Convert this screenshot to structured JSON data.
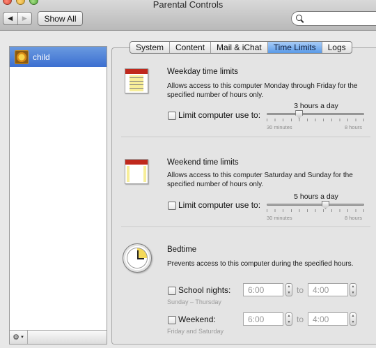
{
  "window": {
    "title": "Parental Controls",
    "show_all_label": "Show All",
    "back_glyph": "◀",
    "forward_glyph": "▶"
  },
  "search": {
    "value": "",
    "placeholder": ""
  },
  "sidebar": {
    "accounts": [
      {
        "name": "child",
        "avatar_icon": "flower-avatar"
      }
    ],
    "footer": {
      "gear_glyph": "⚙",
      "chevron_glyph": "▼"
    }
  },
  "tabs": [
    {
      "label": "System",
      "active": false
    },
    {
      "label": "Content",
      "active": false
    },
    {
      "label": "Mail & iChat",
      "active": false
    },
    {
      "label": "Time Limits",
      "active": true
    },
    {
      "label": "Logs",
      "active": false
    }
  ],
  "weekday": {
    "title": "Weekday time limits",
    "description": "Allows access to this computer Monday through Friday for the specified number of hours only.",
    "checkbox_label": "Limit computer use to:",
    "checked": false,
    "slider_value_label": "3 hours a day",
    "slider_fraction": 0.33,
    "slider_min_label": "30 minutes",
    "slider_max_label": "8 hours",
    "icon": "calendar-icon"
  },
  "weekend": {
    "title": "Weekend time limits",
    "description": "Allows access to this computer Saturday and Sunday for the specified number of hours only.",
    "checkbox_label": "Limit computer use to:",
    "checked": false,
    "slider_value_label": "5 hours a day",
    "slider_fraction": 0.6,
    "slider_min_label": "30 minutes",
    "slider_max_label": "8 hours",
    "icon": "calendar-icon"
  },
  "bedtime": {
    "title": "Bedtime",
    "description": "Prevents access to this computer during the specified hours.",
    "icon": "clock-icon",
    "school_nights": {
      "label": "School nights:",
      "checked": false,
      "sub_label": "Sunday – Thursday",
      "from": "6:00",
      "to_label": "to",
      "to": "4:00"
    },
    "weekend": {
      "label": "Weekend:",
      "checked": false,
      "sub_label": "Friday and Saturday",
      "from": "6:00",
      "to_label": "to",
      "to": "4:00"
    }
  },
  "colors": {
    "accent": "#5a9ae8",
    "selection": "#3c6fd0",
    "calendar_red": "#c0281c",
    "clock_yellow": "#f4d95a"
  }
}
